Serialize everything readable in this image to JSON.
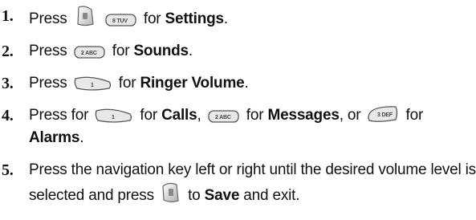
{
  "steps": [
    {
      "number": "1.",
      "parts": [
        {
          "text": "Press"
        },
        {
          "key": "menu",
          "icon": "menu-softkey-icon"
        },
        {
          "key": "8",
          "label": "8 TUV",
          "icon": "key-8-icon"
        },
        {
          "text": "for"
        },
        {
          "text": "Settings",
          "bold": true
        },
        {
          "text": "."
        }
      ]
    },
    {
      "number": "2.",
      "parts": [
        {
          "text": "Press"
        },
        {
          "key": "2",
          "label": "2 ABC",
          "icon": "key-2-icon"
        },
        {
          "text": "for"
        },
        {
          "text": "Sounds",
          "bold": true
        },
        {
          "text": "."
        }
      ]
    },
    {
      "number": "3.",
      "parts": [
        {
          "text": "Press"
        },
        {
          "key": "1",
          "label": "1",
          "icon": "key-1-icon"
        },
        {
          "text": "for"
        },
        {
          "text": "Ringer Volume",
          "bold": true
        },
        {
          "text": "."
        }
      ]
    },
    {
      "number": "4.",
      "parts": [
        {
          "text": "Press for"
        },
        {
          "key": "1",
          "label": "1",
          "icon": "key-1-icon"
        },
        {
          "text": "for"
        },
        {
          "text": "Calls",
          "bold": true
        },
        {
          "text": ","
        },
        {
          "key": "2",
          "label": "2 ABC",
          "icon": "key-2-icon"
        },
        {
          "text": "for"
        },
        {
          "text": "Messages",
          "bold": true
        },
        {
          "text": ", or"
        },
        {
          "key": "3",
          "label": "3 DEF",
          "icon": "key-3-icon"
        },
        {
          "text": "for"
        },
        {
          "text": "Alarms",
          "bold": true
        },
        {
          "text": "."
        }
      ]
    },
    {
      "number": "5.",
      "parts": [
        {
          "text": "Press the navigation key left or right until the desired volume level is selected and press"
        },
        {
          "key": "ok",
          "icon": "ok-softkey-icon"
        },
        {
          "text": "to"
        },
        {
          "text": "Save",
          "bold": true
        },
        {
          "text": "and exit."
        }
      ]
    }
  ],
  "colors": {
    "text": "#111111",
    "key_face": "#e8e8e8",
    "key_border": "#555555"
  }
}
